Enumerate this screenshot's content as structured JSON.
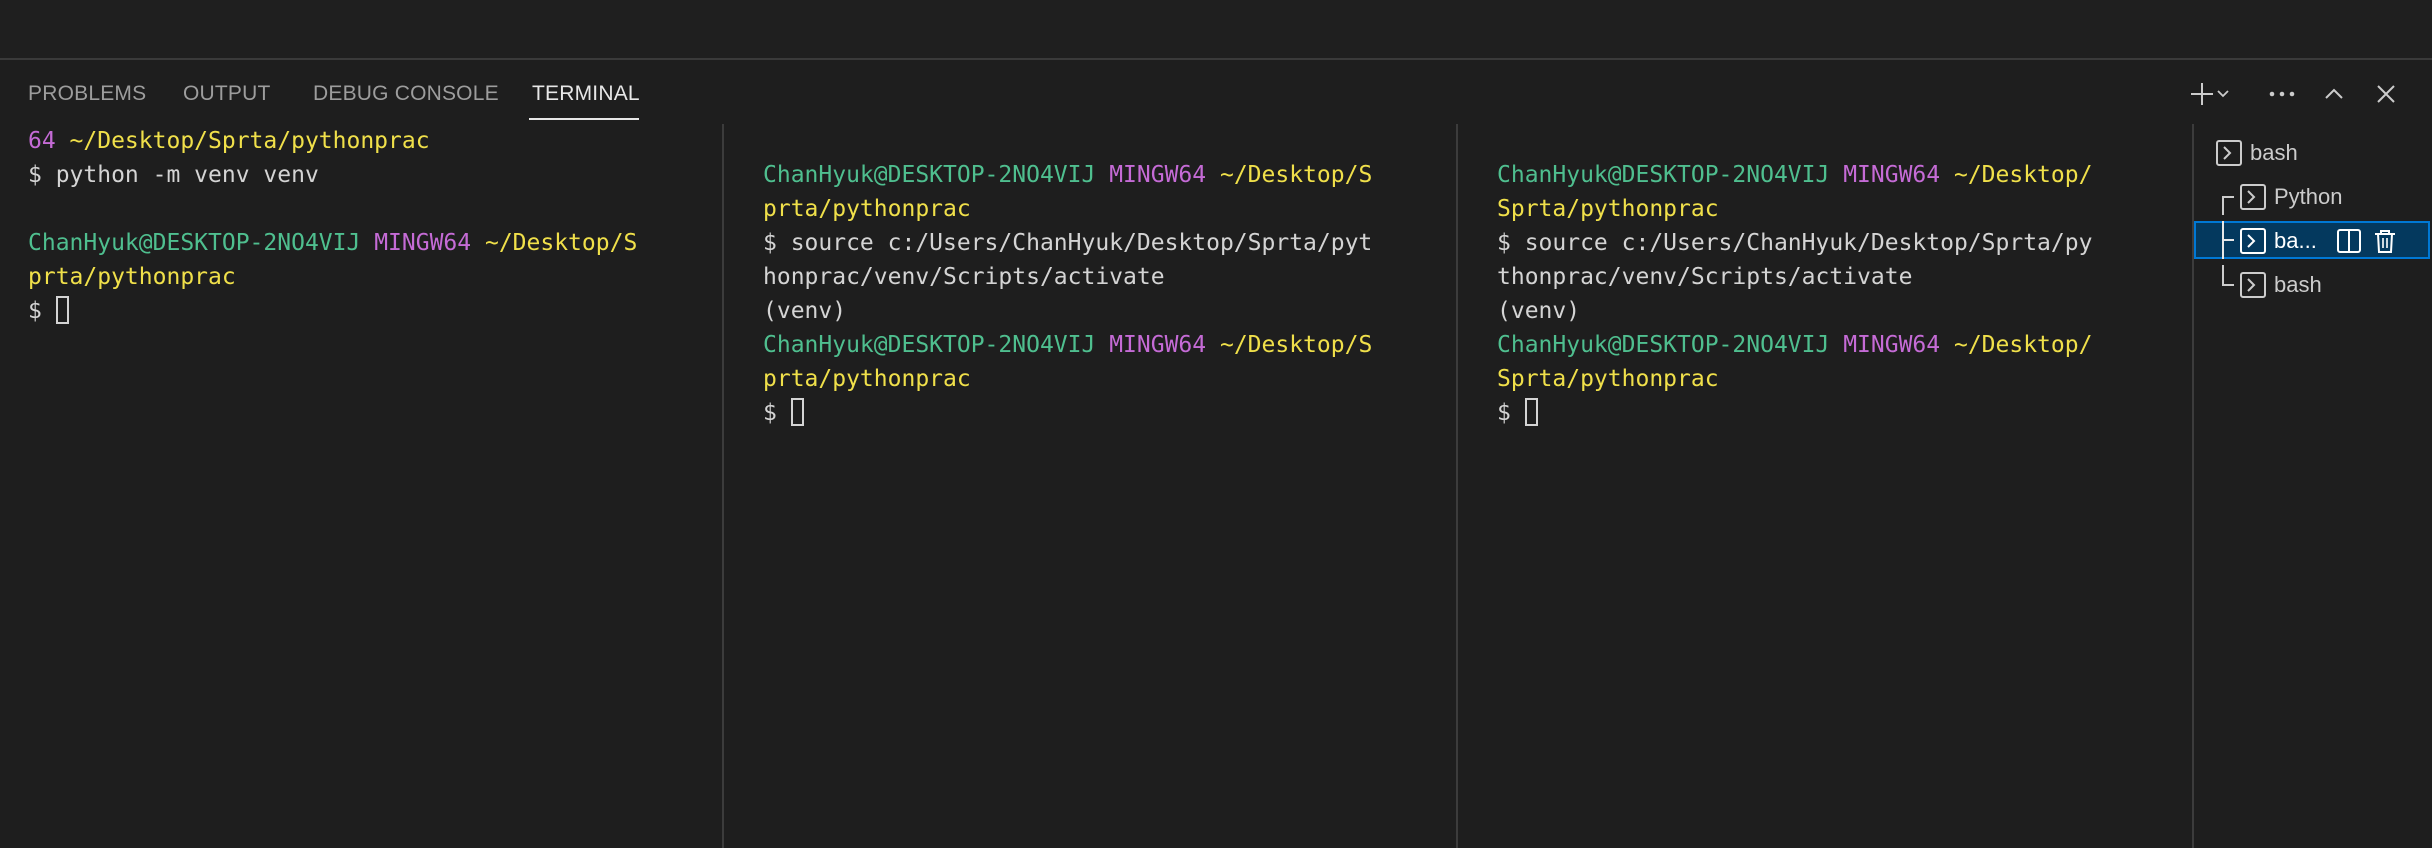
{
  "panel": {
    "tabs": [
      {
        "label": "PROBLEMS"
      },
      {
        "label": "OUTPUT"
      },
      {
        "label": "DEBUG CONSOLE"
      },
      {
        "label": "TERMINAL"
      }
    ],
    "active_tab": "TERMINAL",
    "actions": [
      "plus-icon",
      "chevron-down-icon",
      "more-icon",
      "chevron-up-icon",
      "close-icon"
    ]
  },
  "terminals": [
    {
      "lines": [
        [
          {
            "t": "64 ",
            "c": "magenta"
          },
          {
            "t": "~/Desktop/Sprta/pythonprac",
            "c": "yellow"
          }
        ],
        [
          {
            "t": "$ python -m venv venv",
            "c": "plain"
          }
        ],
        [],
        [
          {
            "t": "ChanHyuk@DESKTOP-2NO4VIJ ",
            "c": "green"
          },
          {
            "t": "MINGW64 ",
            "c": "magenta"
          },
          {
            "t": "~/Desktop/S",
            "c": "yellow"
          }
        ],
        [
          {
            "t": "prta/pythonprac",
            "c": "yellow"
          }
        ],
        [
          {
            "t": "$ ",
            "c": "plain"
          }
        ]
      ]
    },
    {
      "lines": [
        [],
        [
          {
            "t": "ChanHyuk@DESKTOP-2NO4VIJ ",
            "c": "green"
          },
          {
            "t": "MINGW64 ",
            "c": "magenta"
          },
          {
            "t": "~/Desktop/S",
            "c": "yellow"
          }
        ],
        [
          {
            "t": "prta/pythonprac",
            "c": "yellow"
          }
        ],
        [
          {
            "t": "$ source c:/Users/ChanHyuk/Desktop/Sprta/pyt",
            "c": "plain"
          }
        ],
        [
          {
            "t": "honprac/venv/Scripts/activate",
            "c": "plain"
          }
        ],
        [
          {
            "t": "(venv)",
            "c": "plain"
          }
        ],
        [
          {
            "t": "ChanHyuk@DESKTOP-2NO4VIJ ",
            "c": "green"
          },
          {
            "t": "MINGW64 ",
            "c": "magenta"
          },
          {
            "t": "~/Desktop/S",
            "c": "yellow"
          }
        ],
        [
          {
            "t": "prta/pythonprac",
            "c": "yellow"
          }
        ],
        [
          {
            "t": "$ ",
            "c": "plain"
          }
        ]
      ]
    },
    {
      "lines": [
        [],
        [
          {
            "t": "ChanHyuk@DESKTOP-2NO4VIJ ",
            "c": "green"
          },
          {
            "t": "MINGW64 ",
            "c": "magenta"
          },
          {
            "t": "~/Desktop/",
            "c": "yellow"
          }
        ],
        [
          {
            "t": "Sprta/pythonprac",
            "c": "yellow"
          }
        ],
        [
          {
            "t": "$ source c:/Users/ChanHyuk/Desktop/Sprta/py",
            "c": "plain"
          }
        ],
        [
          {
            "t": "thonprac/venv/Scripts/activate",
            "c": "plain"
          }
        ],
        [
          {
            "t": "(venv)",
            "c": "plain"
          }
        ],
        [
          {
            "t": "ChanHyuk@DESKTOP-2NO4VIJ ",
            "c": "green"
          },
          {
            "t": "MINGW64 ",
            "c": "magenta"
          },
          {
            "t": "~/Desktop/",
            "c": "yellow"
          }
        ],
        [
          {
            "t": "Sprta/pythonprac",
            "c": "yellow"
          }
        ],
        [
          {
            "t": "$ ",
            "c": "plain"
          }
        ]
      ]
    }
  ],
  "terminal_list": {
    "items": [
      {
        "label": "bash"
      },
      {
        "label": "Python"
      },
      {
        "label": "ba..."
      },
      {
        "label": "bash"
      }
    ],
    "selected_label": "ba..."
  },
  "colors": {
    "green": "#4fbf8f",
    "magenta": "#c56bd6",
    "yellow": "#f0e04a",
    "plain": "#d4d4d4",
    "selection": "#04395e",
    "focus_border": "#0078d4"
  }
}
